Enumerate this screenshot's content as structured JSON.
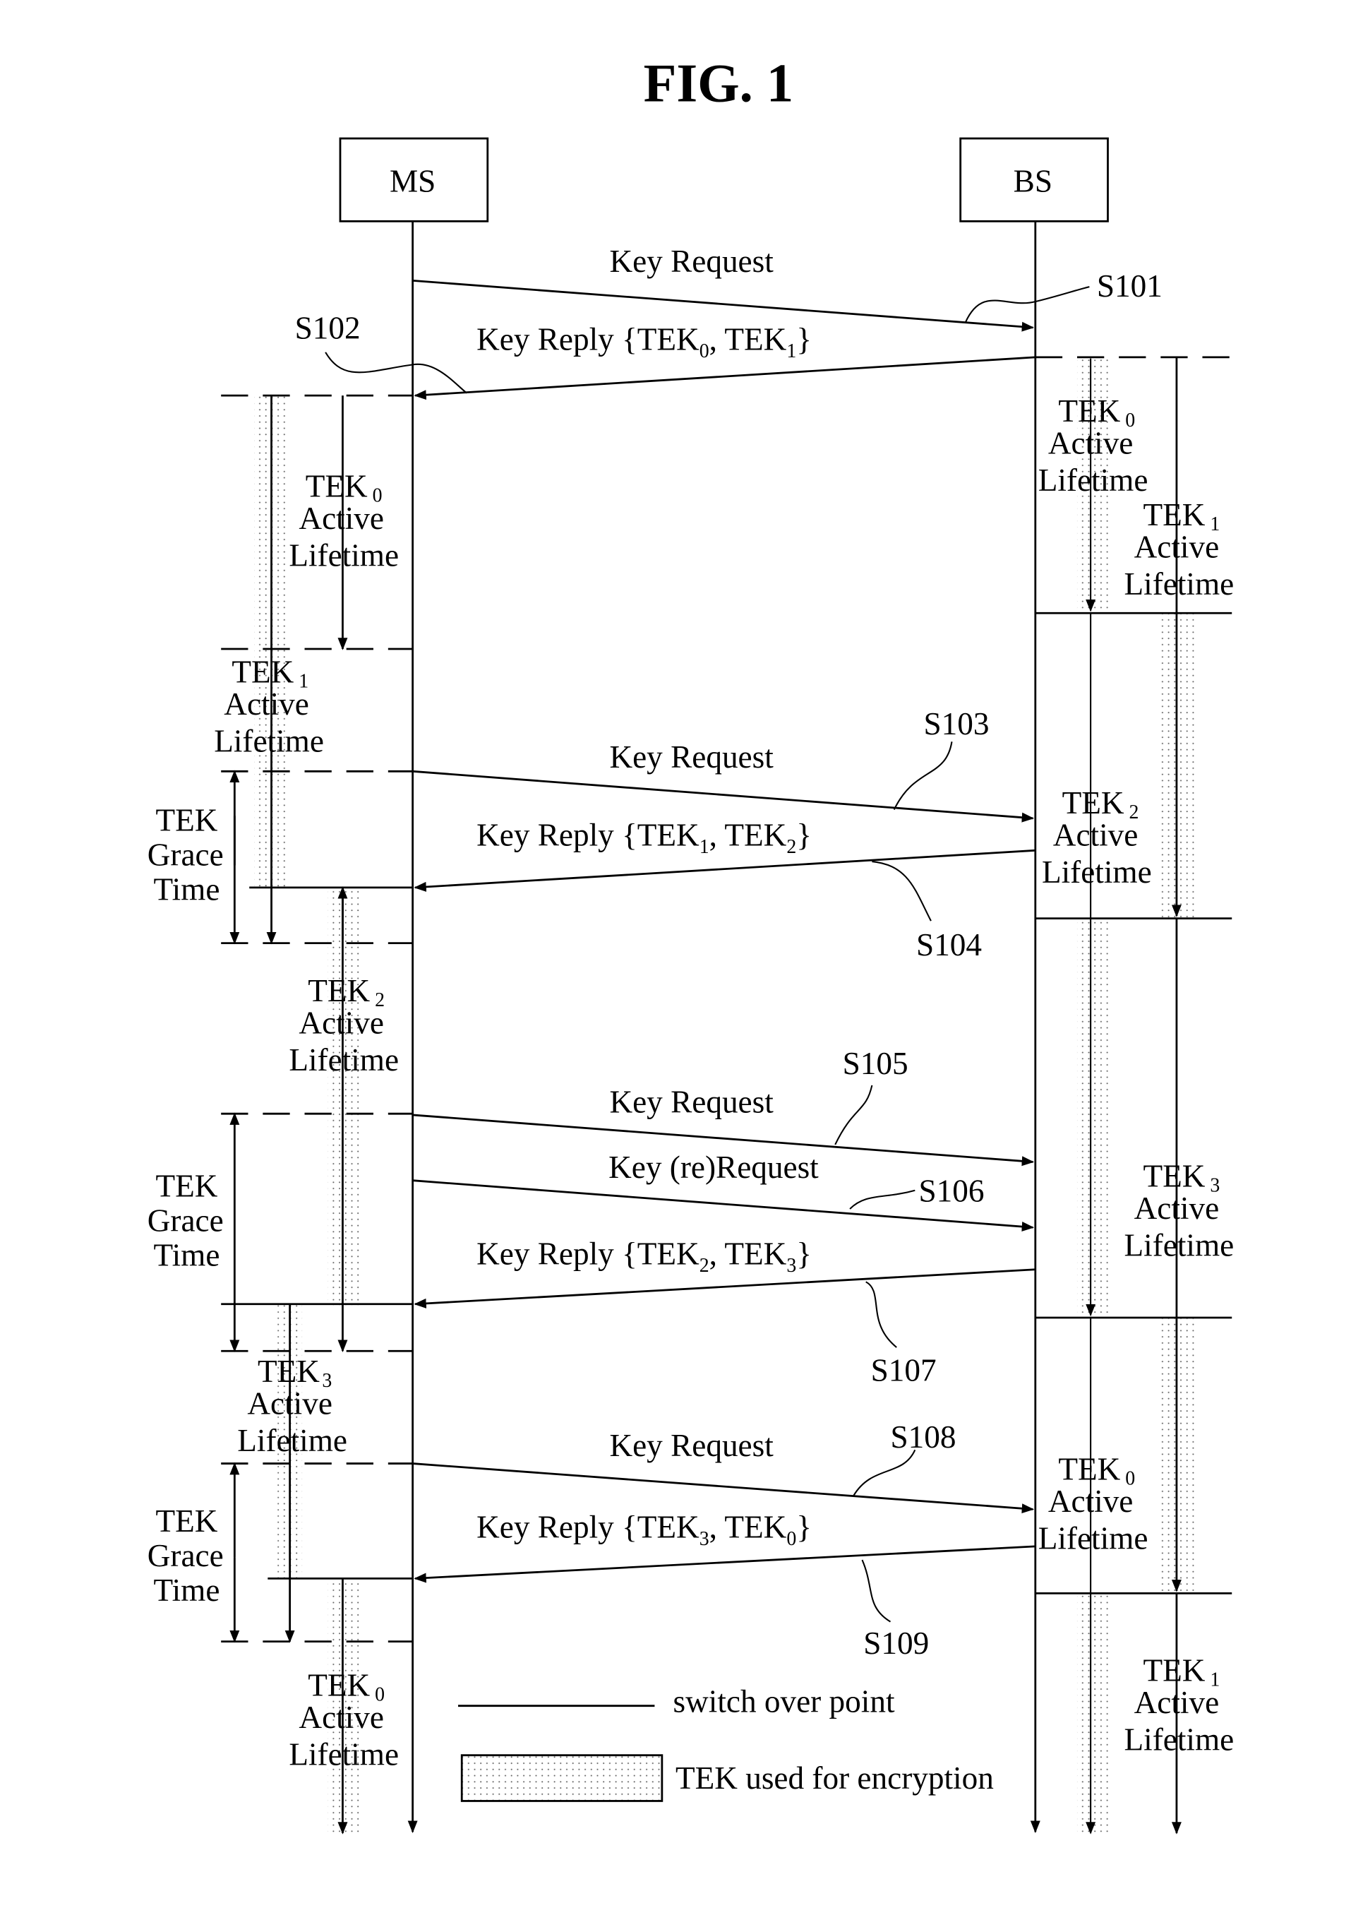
{
  "title": "FIG. 1",
  "entities": {
    "ms": "MS",
    "bs": "BS"
  },
  "messages": [
    {
      "label": "Key Request",
      "step": "S101"
    },
    {
      "label": "Key Reply {TEK",
      "k1": "0",
      "k2": "1",
      "step": "S102"
    },
    {
      "label": "Key Request",
      "step": "S103"
    },
    {
      "label": "Key Reply {TEK",
      "k1": "1",
      "k2": "2",
      "step": "S104"
    },
    {
      "label": "Key Request",
      "step": "S105"
    },
    {
      "label": "Key (re)Request",
      "step": "S106"
    },
    {
      "label": "Key Reply {TEK",
      "k1": "2",
      "k2": "3",
      "step": "S107"
    },
    {
      "label": "Key Request",
      "step": "S108"
    },
    {
      "label": "Key Reply {TEK",
      "k1": "3",
      "k2": "0",
      "step": "S109"
    }
  ],
  "text": {
    "tek": "TEK",
    "active": "Active",
    "lifetime": "Lifetime",
    "grace": "Grace",
    "time": "Time",
    "comma": ", TEK",
    "close": "}"
  },
  "ms_lifetimes": [
    "0",
    "1",
    "2",
    "3",
    "0"
  ],
  "bs_lifetimes": [
    "0",
    "1",
    "2",
    "3",
    "0",
    "1"
  ],
  "legend": {
    "switch": "switch over point",
    "encryption": "TEK used for encryption"
  }
}
